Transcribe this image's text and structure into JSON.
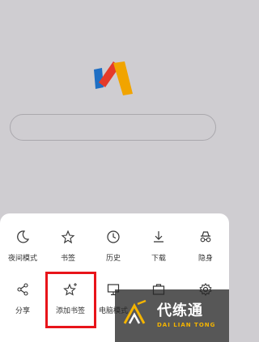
{
  "menu": {
    "row1": [
      {
        "label": "夜间模式",
        "icon": "moon-icon"
      },
      {
        "label": "书签",
        "icon": "star-icon"
      },
      {
        "label": "历史",
        "icon": "clock-icon"
      },
      {
        "label": "下载",
        "icon": "download-icon"
      },
      {
        "label": "隐身",
        "icon": "incognito-icon"
      }
    ],
    "row2": [
      {
        "label": "分享",
        "icon": "share-icon"
      },
      {
        "label": "添加书签",
        "icon": "star-add-icon"
      },
      {
        "label": "电脑模式",
        "icon": "desktop-icon"
      },
      {
        "label": "",
        "icon": "toolbox-icon"
      },
      {
        "label": "",
        "icon": "gear-icon"
      }
    ]
  },
  "watermark": {
    "title": "代练通",
    "subtitle": "DAI LIAN TONG"
  },
  "colors": {
    "highlight": "#e8141a",
    "logo_red": "#e53a2a",
    "logo_blue": "#1f6fc4",
    "logo_yellow": "#f1a400"
  }
}
